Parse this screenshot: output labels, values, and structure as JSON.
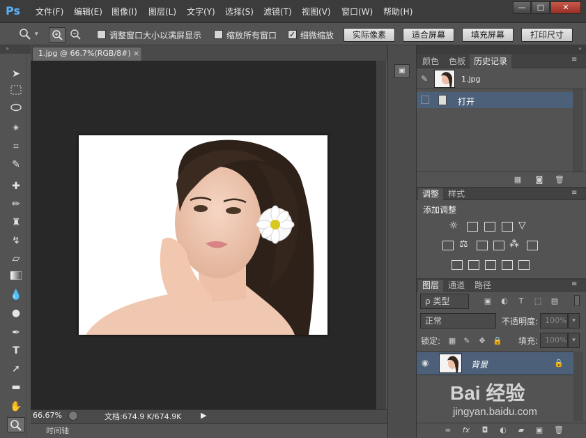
{
  "menubar": {
    "logo": "Ps",
    "items": [
      "文件(F)",
      "编辑(E)",
      "图像(I)",
      "图层(L)",
      "文字(Y)",
      "选择(S)",
      "滤镜(T)",
      "视图(V)",
      "窗口(W)",
      "帮助(H)"
    ],
    "window_buttons": [
      "—",
      "□",
      "✕"
    ]
  },
  "options": {
    "resize_windows_label": "调整窗口大小以满屏显示",
    "zoom_all_label": "缩放所有窗口",
    "scrubby_zoom_label": "细微缩放",
    "actual_pixels": "实际像素",
    "fit_screen": "适合屏幕",
    "fill_screen": "填充屏幕",
    "print_size": "打印尺寸"
  },
  "document": {
    "tab_label": "1.jpg @ 66.7%(RGB/8#)",
    "tab_close": "×"
  },
  "status": {
    "zoom": "66.67%",
    "doc_info": "文档:674.9 K/674.9K"
  },
  "timeline": {
    "label": "时间轴"
  },
  "panels": {
    "top_tabs": [
      "颜色",
      "色板",
      "历史记录"
    ],
    "history": {
      "snapshot": "1.jpg",
      "items": [
        "打开"
      ]
    },
    "adj_tabs": [
      "调整",
      "样式"
    ],
    "adj_title": "添加调整",
    "layers_tabs": [
      "图层",
      "通道",
      "路径"
    ],
    "layers": {
      "filter_kind": "ρ 类型",
      "blend_mode": "正常",
      "opacity_label": "不透明度:",
      "opacity_value": "100%",
      "lock_label": "锁定:",
      "fill_label": "填充:",
      "fill_value": "100%",
      "layer_name": "背景"
    }
  },
  "watermark": {
    "brand": "Bai 经验",
    "url": "jingyan.baidu.com"
  }
}
